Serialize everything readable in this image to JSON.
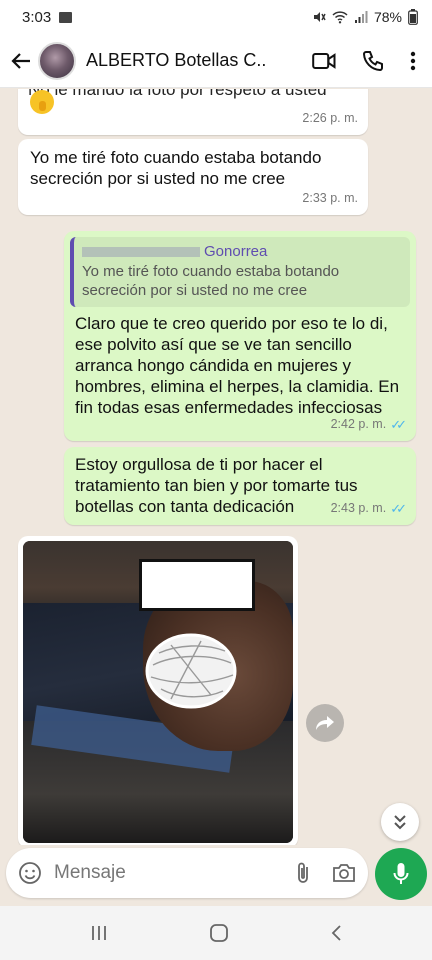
{
  "status_bar": {
    "time": "3:03",
    "battery": "78%"
  },
  "header": {
    "contact_name": "ALBERTO Botellas C..."
  },
  "messages": {
    "m1": {
      "text": "No le mando la foto por respeto a usted",
      "time": "2:26 p. m."
    },
    "m2": {
      "text": "Yo me tiré foto cuando estaba botando secreción por si usted no me cree",
      "time": "2:33 p. m."
    },
    "m3": {
      "quote_author": "Gonorrea",
      "quote_text": "Yo me tiré foto cuando estaba botando secreción por si usted no me cree",
      "text": "Claro que te creo querido por eso te lo di, ese polvito así que se ve tan sencillo arranca hongo cándida en mujeres y hombres, elimina el herpes, la clamidia. En fin todas esas enfermedades infecciosas",
      "time": "2:42 p. m."
    },
    "m4": {
      "text": "Estoy orgullosa de ti por hacer el tratamiento tan bien y por tomarte tus botellas con tanta dedicación",
      "time": "2:43 p. m."
    }
  },
  "input": {
    "placeholder": "Mensaje"
  },
  "colors": {
    "outgoing_bubble": "#dcf8c6",
    "incoming_bubble": "#ffffff",
    "accent_green": "#1ea853",
    "read_ticks": "#4fb6ec",
    "quote_bar": "#5f4db0"
  }
}
